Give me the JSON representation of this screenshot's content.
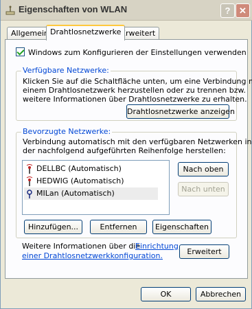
{
  "window": {
    "title": "Eigenschaften von WLAN",
    "help_label": "?",
    "close_label": "✕"
  },
  "tabs": [
    {
      "label": "Allgemein"
    },
    {
      "label": "Drahtlosnetzwerke",
      "active": true
    },
    {
      "label": "Erweitert"
    }
  ],
  "config_checkbox": {
    "label": "Windows zum Konfigurieren der Einstellungen verwenden",
    "checked": true
  },
  "available_networks": {
    "title": "Verfügbare Netzwerke:",
    "lines": [
      "Klicken Sie auf die Schaltfläche unten, um eine Verbindung mit",
      "einem Drahtlosnetzwerk herzustellen oder zu trennen bzw.",
      "weitere Informationen über Drahtlosnetzwerke zu erhalten."
    ],
    "show_button": "Drahtlosnetzwerke anzeigen"
  },
  "preferred_networks": {
    "title": "Bevorzugte Netzwerke:",
    "lines": [
      "Verbindung automatisch mit den verfügbaren Netzwerken in",
      "der nachfolgend aufgeführten Reihenfolge herstellen:"
    ],
    "items": [
      {
        "label": "DELLBC (Automatisch)",
        "icon": "wireless-network-icon"
      },
      {
        "label": "HEDWIG (Automatisch)",
        "icon": "wireless-network-icon"
      },
      {
        "label": "MILan (Automatisch)",
        "icon": "wireless-network-secure-icon",
        "selected": true
      }
    ],
    "move_up": "Nach oben",
    "move_down": "Nach unten",
    "add": "Hinzufügen...",
    "remove": "Entfernen",
    "properties": "Eigenschaften"
  },
  "info": {
    "text": "Weitere Informationen über die",
    "link_part1": "Einrichtung",
    "link_part2": "einer Drahtlosnetzwerkkonfiguration.",
    "advanced_button": "Erweitert"
  },
  "footer": {
    "ok": "OK",
    "cancel": "Abbrechen"
  },
  "colors": {
    "group_title": "#0046d5",
    "tab_highlight": "#ffc83c",
    "link": "#0046d5"
  }
}
